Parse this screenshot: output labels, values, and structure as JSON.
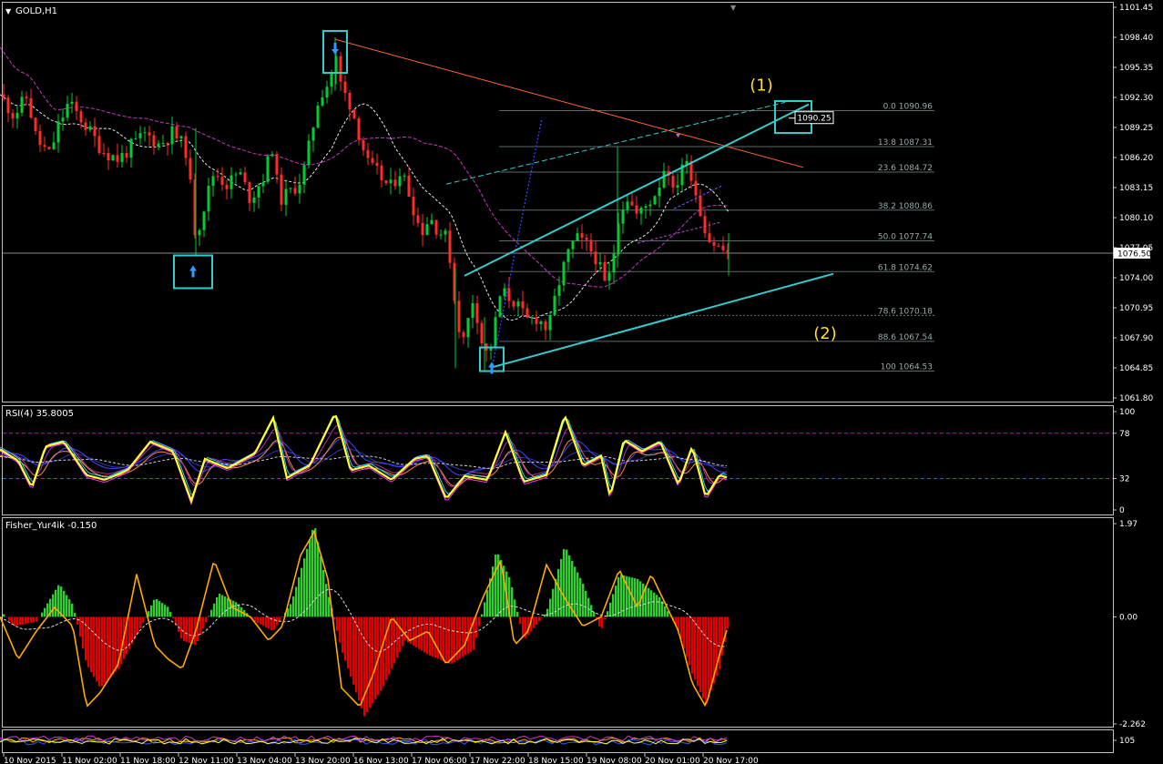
{
  "window": {
    "title": "GOLD,H1"
  },
  "colors": {
    "background": "#000000",
    "frame": "#c0c0c0",
    "bull": "#00cc33",
    "bear": "#ff2a2a",
    "ma_slow": "#cc33cc",
    "ma_fast": "#e6e6e6",
    "channel": "#33cccc",
    "resistance": "#ff6633",
    "fib": "#5a6a6a",
    "annotation": "#ffdd33",
    "rsi": "#ffff33",
    "fisher_line": "#ffaa00",
    "fisher_up": "#33cc33",
    "fisher_down": "#e00000"
  },
  "icons": [
    "arrow-down-icon",
    "arrow-up-icon",
    "dropdown-triangle-icon"
  ],
  "chart_data": [
    {
      "type": "candlestick",
      "title": "GOLD,H1",
      "ylim": [
        1061.8,
        1101.45
      ],
      "y_ticks": [
        "1101.45",
        "1098.40",
        "1095.35",
        "1092.30",
        "1089.25",
        "1086.20",
        "1083.15",
        "1080.10",
        "1077.05",
        "1074.00",
        "1070.95",
        "1067.90",
        "1064.85",
        "1061.80"
      ],
      "current_price": "1076.50",
      "x_ticks": [
        "10 Nov 2015",
        "11 Nov 02:00",
        "11 Nov 18:00",
        "12 Nov 11:00",
        "13 Nov 04:00",
        "13 Nov 20:00",
        "16 Nov 13:00",
        "17 Nov 06:00",
        "17 Nov 22:00",
        "18 Nov 15:00",
        "19 Nov 08:00",
        "20 Nov 01:00",
        "20 Nov 17:00"
      ],
      "price_path": [
        [
          0,
          1092.6
        ],
        [
          15,
          1090.5
        ],
        [
          30,
          1092.4
        ],
        [
          40,
          1088.0
        ],
        [
          55,
          1086.4
        ],
        [
          62,
          1089.0
        ],
        [
          75,
          1091.7
        ],
        [
          90,
          1090.0
        ],
        [
          112,
          1087.0
        ],
        [
          130,
          1086.0
        ],
        [
          145,
          1087.4
        ],
        [
          160,
          1088.6
        ],
        [
          175,
          1087.5
        ],
        [
          190,
          1088.8
        ],
        [
          205,
          1086.8
        ],
        [
          215,
          1078.0
        ],
        [
          222,
          1080.6
        ],
        [
          235,
          1084.8
        ],
        [
          250,
          1083.4
        ],
        [
          262,
          1084.8
        ],
        [
          275,
          1082.0
        ],
        [
          290,
          1084.4
        ],
        [
          300,
          1087.6
        ],
        [
          306,
          1081.8
        ],
        [
          320,
          1082.8
        ],
        [
          332,
          1084.2
        ],
        [
          340,
          1087.6
        ],
        [
          350,
          1092.4
        ],
        [
          362,
          1094.0
        ],
        [
          368,
          1096.6
        ],
        [
          375,
          1093.2
        ],
        [
          385,
          1091.6
        ],
        [
          395,
          1088.4
        ],
        [
          405,
          1085.2
        ],
        [
          415,
          1084.6
        ],
        [
          428,
          1083.0
        ],
        [
          440,
          1085.0
        ],
        [
          450,
          1082.4
        ],
        [
          462,
          1078.6
        ],
        [
          472,
          1080.2
        ],
        [
          480,
          1079.0
        ],
        [
          492,
          1077.8
        ],
        [
          500,
          1071.0
        ],
        [
          508,
          1067.2
        ],
        [
          520,
          1072.2
        ],
        [
          532,
          1066.0
        ],
        [
          540,
          1067.4
        ],
        [
          550,
          1072.6
        ],
        [
          565,
          1071.6
        ],
        [
          578,
          1069.6
        ],
        [
          590,
          1070.0
        ],
        [
          602,
          1068.6
        ],
        [
          612,
          1073.0
        ],
        [
          622,
          1076.0
        ],
        [
          632,
          1078.0
        ],
        [
          645,
          1077.2
        ],
        [
          655,
          1076.0
        ],
        [
          665,
          1073.0
        ],
        [
          672,
          1075.0
        ],
        [
          678,
          1080.0
        ],
        [
          688,
          1082.4
        ],
        [
          700,
          1080.2
        ],
        [
          712,
          1081.6
        ],
        [
          722,
          1083.0
        ],
        [
          732,
          1086.0
        ],
        [
          740,
          1082.0
        ],
        [
          748,
          1085.8
        ],
        [
          758,
          1085.0
        ],
        [
          768,
          1081.0
        ],
        [
          778,
          1078.0
        ],
        [
          790,
          1077.0
        ],
        [
          800,
          1076.5
        ]
      ],
      "fibonacci": [
        {
          "label": "0.0 1090.96",
          "value": 1090.96
        },
        {
          "label": "13.8 1087.31",
          "value": 1087.31
        },
        {
          "label": "23.6 1084.72",
          "value": 1084.72
        },
        {
          "label": "38.2 1080.86",
          "value": 1080.86
        },
        {
          "label": "50.0 1077.74",
          "value": 1077.74
        },
        {
          "label": "61.8 1074.62",
          "value": 1074.62
        },
        {
          "label": "78.6 1070.18",
          "value": 1070.18
        },
        {
          "label": "88.6 1067.54",
          "value": 1067.54
        },
        {
          "label": "100 1064.53",
          "value": 1064.53
        }
      ],
      "trendlines": {
        "resistance": [
          [
            368,
            1098.2
          ],
          [
            882,
            1085.2
          ]
        ],
        "channel_upper": [
          [
            510,
            1074.2
          ],
          [
            888,
            1091.6
          ]
        ],
        "channel_lower": [
          [
            540,
            1064.9
          ],
          [
            915,
            1074.4
          ]
        ],
        "dashed_upper": [
          [
            490,
            1083.5
          ],
          [
            862,
            1091.8
          ]
        ]
      },
      "annotations": [
        {
          "text": "(1)",
          "at": [
            836,
            1093.0
          ]
        },
        {
          "text": "(2)",
          "at": [
            906,
            1067.8
          ]
        }
      ],
      "price_label": {
        "text": "1090.25",
        "at": [
          893,
          1090.2
        ]
      },
      "markers": [
        {
          "kind": "arrow-down",
          "at": [
            368,
            1097.2
          ]
        },
        {
          "kind": "arrow-up",
          "at": [
            212,
            1074.6
          ]
        },
        {
          "kind": "arrow-up",
          "at": [
            540,
            1064.8
          ]
        }
      ]
    },
    {
      "type": "line",
      "title": "RSI(4) 35.8005",
      "ylim": [
        0,
        100
      ],
      "y_ticks": [
        "100",
        "78",
        "32",
        "0"
      ],
      "levels": [
        78,
        32
      ],
      "series": [
        {
          "name": "RSI(4) 35.8005",
          "values_path": [
            [
              0,
              62
            ],
            [
              20,
              50
            ],
            [
              35,
              22
            ],
            [
              50,
              65
            ],
            [
              70,
              70
            ],
            [
              95,
              35
            ],
            [
              115,
              30
            ],
            [
              140,
              40
            ],
            [
              165,
              70
            ],
            [
              190,
              60
            ],
            [
              210,
              8
            ],
            [
              225,
              52
            ],
            [
              250,
              42
            ],
            [
              280,
              58
            ],
            [
              300,
              95
            ],
            [
              315,
              32
            ],
            [
              340,
              45
            ],
            [
              368,
              100
            ],
            [
              385,
              40
            ],
            [
              405,
              45
            ],
            [
              430,
              30
            ],
            [
              455,
              52
            ],
            [
              470,
              55
            ],
            [
              490,
              10
            ],
            [
              510,
              34
            ],
            [
              535,
              30
            ],
            [
              555,
              80
            ],
            [
              575,
              28
            ],
            [
              600,
              35
            ],
            [
              620,
              98
            ],
            [
              640,
              45
            ],
            [
              660,
              55
            ],
            [
              670,
              12
            ],
            [
              685,
              72
            ],
            [
              705,
              60
            ],
            [
              725,
              70
            ],
            [
              745,
              25
            ],
            [
              760,
              65
            ],
            [
              775,
              12
            ],
            [
              790,
              35
            ],
            [
              800,
              32
            ]
          ]
        }
      ]
    },
    {
      "type": "bar",
      "title": "Fisher_Yur4ik -0.150",
      "ylim": [
        -2.262,
        1.97
      ],
      "y_ticks": [
        "1.97",
        "0.00",
        "-2.262"
      ],
      "histogram_path": [
        [
          0,
          0.15
        ],
        [
          15,
          -0.2
        ],
        [
          40,
          -0.1
        ],
        [
          65,
          0.7
        ],
        [
          80,
          0.25
        ],
        [
          95,
          -1.0
        ],
        [
          110,
          -1.5
        ],
        [
          130,
          -1.1
        ],
        [
          150,
          -0.4
        ],
        [
          170,
          0.4
        ],
        [
          185,
          0.2
        ],
        [
          200,
          -0.5
        ],
        [
          215,
          -0.6
        ],
        [
          240,
          0.5
        ],
        [
          260,
          0.3
        ],
        [
          280,
          -0.1
        ],
        [
          300,
          -0.3
        ],
        [
          320,
          0.3
        ],
        [
          345,
          1.97
        ],
        [
          360,
          0.5
        ],
        [
          375,
          -0.7
        ],
        [
          400,
          -2.1
        ],
        [
          420,
          -1.5
        ],
        [
          445,
          -0.5
        ],
        [
          470,
          -0.8
        ],
        [
          495,
          -1.0
        ],
        [
          520,
          -0.7
        ],
        [
          545,
          1.4
        ],
        [
          560,
          0.8
        ],
        [
          575,
          -0.5
        ],
        [
          600,
          0.1
        ],
        [
          620,
          1.5
        ],
        [
          640,
          0.7
        ],
        [
          660,
          -0.3
        ],
        [
          680,
          0.9
        ],
        [
          700,
          0.8
        ],
        [
          725,
          0.4
        ],
        [
          745,
          -0.3
        ],
        [
          760,
          -1.2
        ],
        [
          775,
          -1.85
        ],
        [
          790,
          -1.1
        ],
        [
          800,
          -0.15
        ]
      ],
      "series": [
        {
          "name": "Fisher_Yur4ik -0.150",
          "values_path": [
            [
              0,
              0.0
            ],
            [
              20,
              -0.9
            ],
            [
              40,
              -0.3
            ],
            [
              60,
              0.2
            ],
            [
              80,
              -0.2
            ],
            [
              95,
              -1.9
            ],
            [
              110,
              -1.6
            ],
            [
              130,
              -1.0
            ],
            [
              150,
              0.9
            ],
            [
              170,
              -0.6
            ],
            [
              185,
              -0.9
            ],
            [
              200,
              -1.1
            ],
            [
              215,
              -0.3
            ],
            [
              235,
              1.2
            ],
            [
              255,
              0.2
            ],
            [
              275,
              0.0
            ],
            [
              295,
              -0.5
            ],
            [
              310,
              -0.2
            ],
            [
              330,
              1.3
            ],
            [
              345,
              1.8
            ],
            [
              360,
              0.8
            ],
            [
              375,
              -1.5
            ],
            [
              395,
              -1.9
            ],
            [
              410,
              -1.2
            ],
            [
              430,
              0.0
            ],
            [
              450,
              -0.5
            ],
            [
              470,
              -0.3
            ],
            [
              490,
              -1.0
            ],
            [
              510,
              -0.6
            ],
            [
              530,
              0.4
            ],
            [
              550,
              1.2
            ],
            [
              565,
              -0.6
            ],
            [
              580,
              -0.3
            ],
            [
              600,
              1.1
            ],
            [
              620,
              0.4
            ],
            [
              640,
              -0.2
            ],
            [
              660,
              0.0
            ],
            [
              680,
              1.0
            ],
            [
              700,
              0.2
            ],
            [
              715,
              0.9
            ],
            [
              730,
              0.3
            ],
            [
              745,
              -0.3
            ],
            [
              760,
              -1.4
            ],
            [
              775,
              -1.9
            ],
            [
              790,
              -0.8
            ],
            [
              800,
              -0.15
            ]
          ]
        }
      ]
    },
    {
      "type": "line",
      "ylim": [
        0,
        105
      ],
      "y_ticks": [
        "105"
      ],
      "title": ""
    }
  ]
}
